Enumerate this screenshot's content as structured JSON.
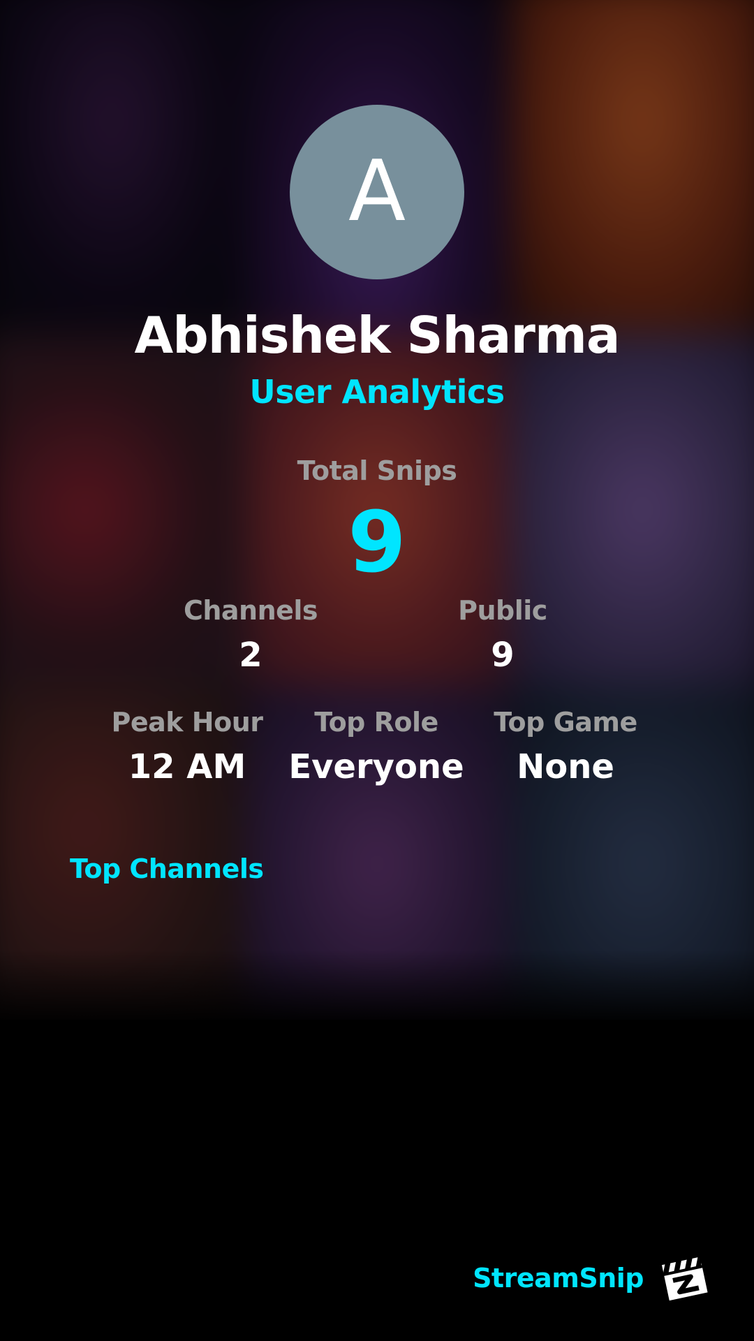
{
  "profile": {
    "avatar_initial": "A",
    "avatar_color": "#78909c",
    "name": "Abhishek Sharma",
    "subtitle": "User Analytics"
  },
  "total": {
    "label": "Total Snips",
    "value": "9"
  },
  "stats_row1": [
    {
      "label": "Channels",
      "value": "2"
    },
    {
      "label": "Public",
      "value": "9"
    }
  ],
  "stats_row2": [
    {
      "label": "Peak Hour",
      "value": "12 AM"
    },
    {
      "label": "Top Role",
      "value": "Everyone"
    },
    {
      "label": "Top Game",
      "value": "None"
    }
  ],
  "top_channels": {
    "heading": "Top Channels"
  },
  "brand": {
    "name": "StreamSnip",
    "logo_icon": "clapperboard-logo-icon"
  },
  "colors": {
    "accent": "#00e5ff",
    "label_gray": "#9e9e9e",
    "background": "#000000"
  }
}
